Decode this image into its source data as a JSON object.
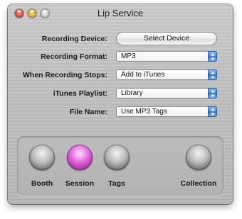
{
  "window": {
    "title": "Lip Service"
  },
  "form": {
    "recording_device": {
      "label": "Recording Device:",
      "button": "Select Device"
    },
    "recording_format": {
      "label": "Recording Format:",
      "value": "MP3"
    },
    "when_stops": {
      "label": "When Recording Stops:",
      "value": "Add to iTunes"
    },
    "itunes_playlist": {
      "label": "iTunes Playlist:",
      "value": "Library"
    },
    "file_name": {
      "label": "File Name:",
      "value": "Use MP3 Tags"
    }
  },
  "buttons": {
    "booth": "Booth",
    "session": "Session",
    "tags": "Tags",
    "collection": "Collection"
  },
  "colors": {
    "accent_blue": "#3e7fd8",
    "session_active": "#e56fe0",
    "traffic_close": "#d23a2c",
    "traffic_min": "#d89a16",
    "traffic_zoom": "#bdbdbd"
  },
  "icons": {
    "close": "close-icon",
    "minimize": "minimize-icon",
    "zoom": "zoom-icon",
    "popup_arrows": "updown-arrows-icon"
  }
}
